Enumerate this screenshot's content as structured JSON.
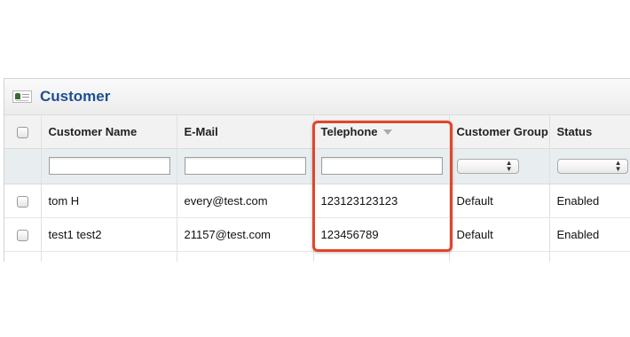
{
  "panel": {
    "title": "Customer",
    "icon": "customer-card-icon"
  },
  "grid": {
    "columns": [
      {
        "key": "select",
        "label": ""
      },
      {
        "key": "name",
        "label": "Customer Name"
      },
      {
        "key": "email",
        "label": "E-Mail"
      },
      {
        "key": "telephone",
        "label": "Telephone",
        "sorted": "desc"
      },
      {
        "key": "group",
        "label": "Customer Group"
      },
      {
        "key": "status",
        "label": "Status"
      }
    ],
    "rows": [
      {
        "name": "tom H",
        "email": "every@test.com",
        "telephone": "123123123123",
        "group": "Default",
        "status": "Enabled"
      },
      {
        "name": "test1 test2",
        "email": "21157@test.com",
        "telephone": "123456789",
        "group": "Default",
        "status": "Enabled"
      }
    ]
  },
  "highlight": {
    "color": "#e2452b",
    "target": "telephone"
  }
}
